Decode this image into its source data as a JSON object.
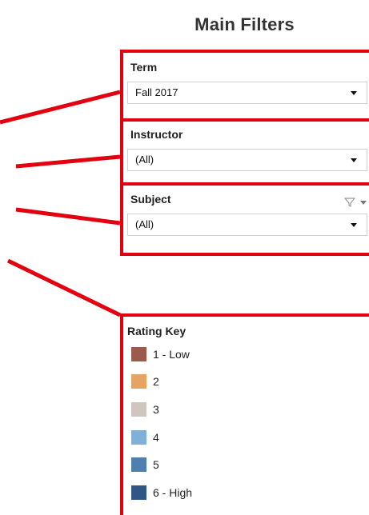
{
  "title": "Main Filters",
  "filters": [
    {
      "label": "Term",
      "value": "Fall 2017",
      "show_filter_icon": false
    },
    {
      "label": "Instructor",
      "value": "(All)",
      "show_filter_icon": false
    },
    {
      "label": "Subject",
      "value": "(All)",
      "show_filter_icon": true
    }
  ],
  "legend": {
    "title": "Rating Key",
    "items": [
      {
        "label": "1 - Low",
        "color": "#9b5b4c"
      },
      {
        "label": "2",
        "color": "#e3a464"
      },
      {
        "label": "3",
        "color": "#cfc6bf"
      },
      {
        "label": "4",
        "color": "#7fb0d8"
      },
      {
        "label": "5",
        "color": "#4f7faf"
      },
      {
        "label": "6 - High",
        "color": "#2f5684"
      }
    ]
  },
  "annotation_color": "#e3000f",
  "icons": [
    "funnel-icon",
    "caret-down-icon"
  ]
}
